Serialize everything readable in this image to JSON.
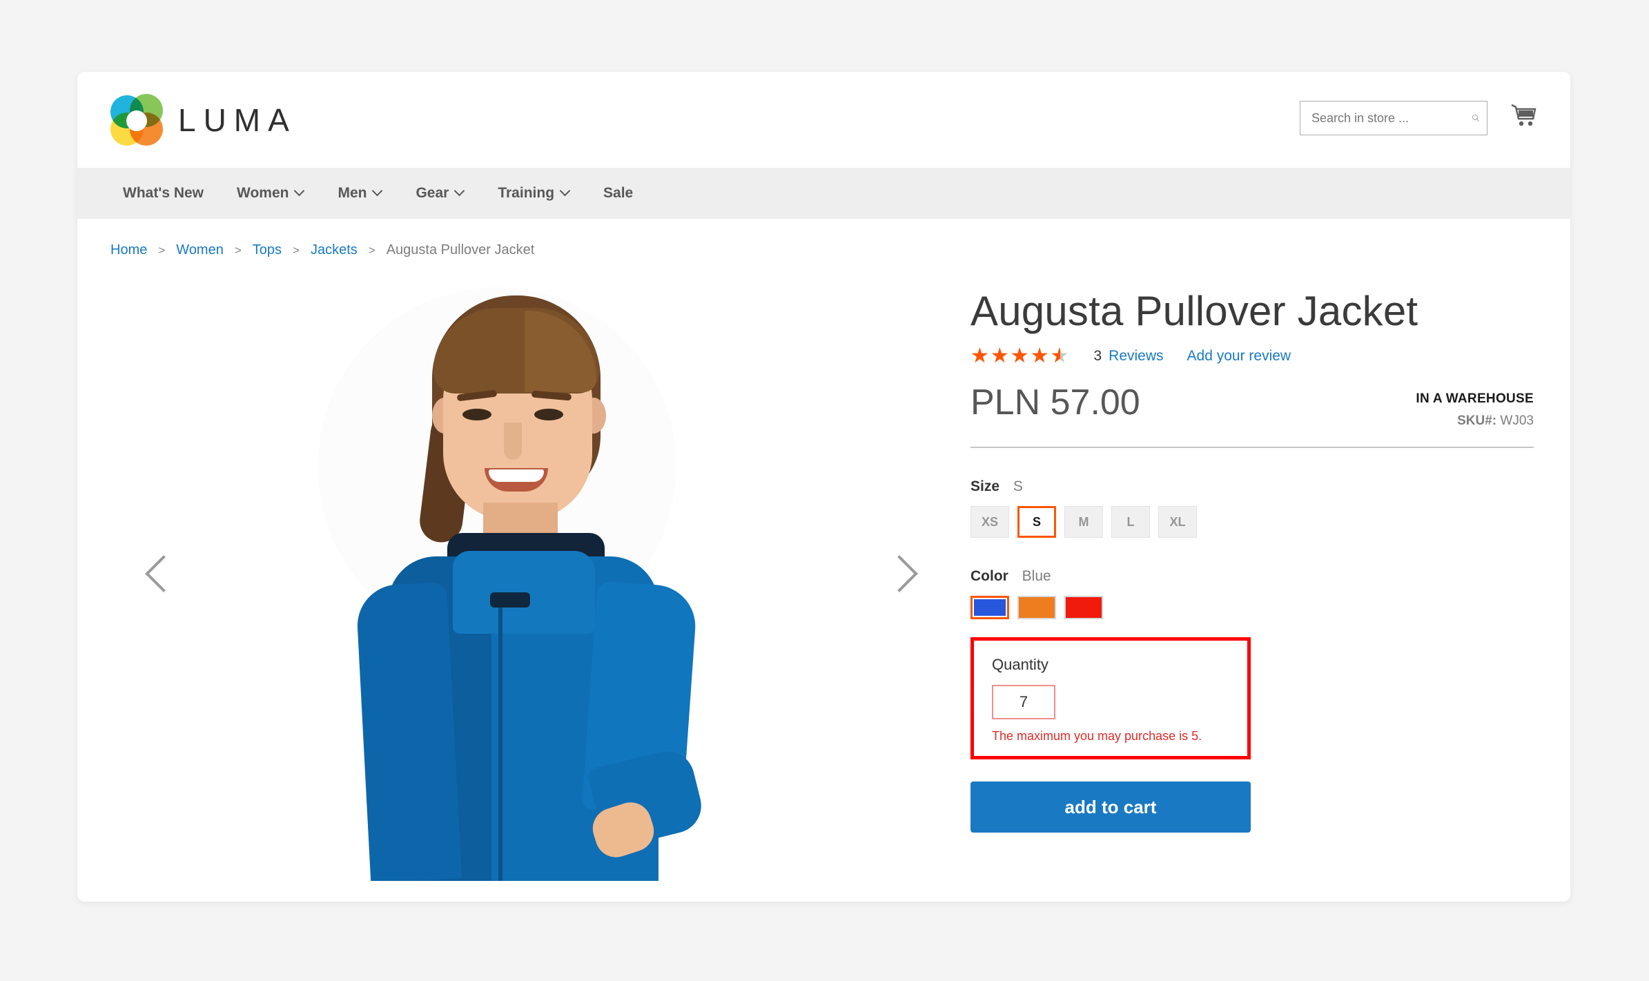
{
  "header": {
    "logo_text": "LUMA",
    "logo_icon": "luma-rings-logo",
    "search": {
      "placeholder": "Search in store ...",
      "value": "",
      "icon": "search-icon"
    },
    "cart_icon": "shopping-cart-icon"
  },
  "nav": {
    "items": [
      {
        "label": "What's New",
        "has_dropdown": false
      },
      {
        "label": "Women",
        "has_dropdown": true
      },
      {
        "label": "Men",
        "has_dropdown": true
      },
      {
        "label": "Gear",
        "has_dropdown": true
      },
      {
        "label": "Training",
        "has_dropdown": true
      },
      {
        "label": "Sale",
        "has_dropdown": false
      }
    ]
  },
  "breadcrumb": {
    "items": [
      "Home",
      "Women",
      "Tops",
      "Jackets"
    ],
    "current": "Augusta Pullover Jacket",
    "separator": ">"
  },
  "gallery": {
    "prev_icon": "chevron-left-icon",
    "next_icon": "chevron-right-icon",
    "image_alt": "Woman wearing blue Augusta Pullover Jacket"
  },
  "product": {
    "title": "Augusta Pullover Jacket",
    "rating_percent": 90,
    "stars_glyphs": "★★★★★",
    "review_count": "3",
    "reviews_label": "Reviews",
    "add_review_label": "Add your review",
    "price": "PLN 57.00",
    "stock_status": "IN A WAREHOUSE",
    "sku_label": "SKU#:",
    "sku_value": "WJ03",
    "size": {
      "label": "Size",
      "selected": "S",
      "options": [
        {
          "label": "XS",
          "selected": false
        },
        {
          "label": "S",
          "selected": true
        },
        {
          "label": "M",
          "selected": false
        },
        {
          "label": "L",
          "selected": false
        },
        {
          "label": "XL",
          "selected": false
        }
      ]
    },
    "color": {
      "label": "Color",
      "selected": "Blue",
      "options": [
        {
          "name": "Blue",
          "hex": "#2657dd",
          "selected": true
        },
        {
          "name": "Orange",
          "hex": "#ed7d1f",
          "selected": false
        },
        {
          "name": "Red",
          "hex": "#f01a0d",
          "selected": false
        }
      ]
    },
    "quantity": {
      "label": "Quantity",
      "value": "7",
      "error": "The maximum you may purchase is 5.",
      "highlight_color": "#ff0000"
    },
    "add_to_cart_label": "add to cart"
  },
  "colors": {
    "accent_blue": "#1979c3",
    "star_orange": "#ff5501",
    "error_red": "#e02b27",
    "page_bg": "#f4f4f4"
  }
}
